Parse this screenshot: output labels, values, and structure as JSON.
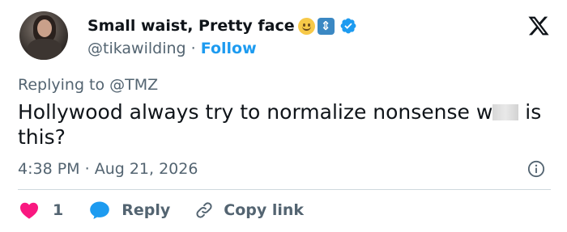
{
  "author": {
    "display_name": "Small waist, Pretty face",
    "handle": "@tikawilding",
    "separator": "·",
    "follow_label": "Follow"
  },
  "tweet": {
    "replying_prefix": "Replying to",
    "replying_to": "@TMZ",
    "text_before": "Hollywood always try to normalize nonsense w",
    "text_after": " is this?",
    "time": "4:38 PM",
    "date_separator": "·",
    "date": "Aug 21, 2026"
  },
  "actions": {
    "like_count": "1",
    "reply_label": "Reply",
    "copy_label": "Copy link"
  },
  "colors": {
    "accent": "#1d9bf0",
    "like": "#f91880",
    "secondary_text": "#536471",
    "primary_text": "#0f1419",
    "divider": "#cfd9de"
  },
  "icons": [
    "x-logo-icon",
    "verified-badge-icon",
    "smiley-emoji-icon",
    "up-down-arrow-emoji-icon",
    "info-icon",
    "heart-icon",
    "reply-bubble-icon",
    "link-icon"
  ]
}
